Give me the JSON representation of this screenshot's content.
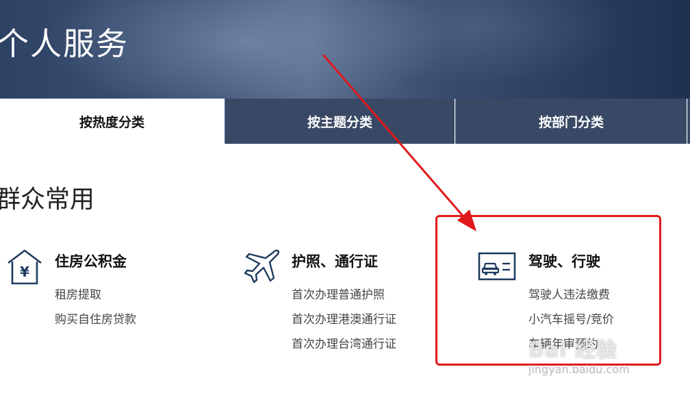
{
  "hero": {
    "title": "个人服务"
  },
  "tabs": [
    {
      "label": "按热度分类",
      "active": true
    },
    {
      "label": "按主题分类",
      "active": false
    },
    {
      "label": "按部门分类",
      "active": false
    }
  ],
  "section": {
    "title": "群众常用"
  },
  "services": [
    {
      "name": "住房公积金",
      "icon": "house-yuan-icon",
      "links": [
        "租房提取",
        "购买自住房贷款"
      ]
    },
    {
      "name": "护照、通行证",
      "icon": "airplane-icon",
      "links": [
        "首次办理普通护照",
        "首次办理港澳通行证",
        "首次办理台湾通行证"
      ]
    },
    {
      "name": "驾驶、行驶",
      "icon": "car-license-icon",
      "links": [
        "驾驶人违法缴费",
        "小汽车摇号/竞价",
        "车辆年审预约"
      ]
    }
  ],
  "annotation": {
    "color": "#e0191b"
  },
  "watermark": {
    "text": "Bai 经验",
    "sub": "jingyan.baidu.com"
  }
}
